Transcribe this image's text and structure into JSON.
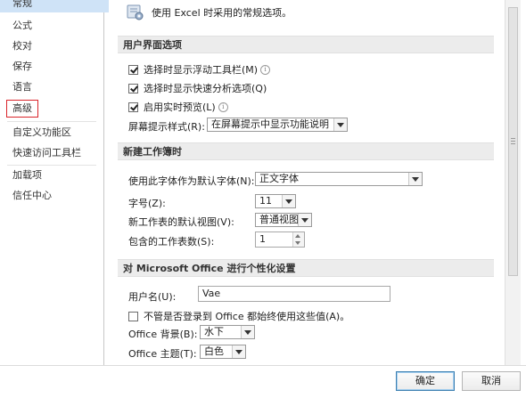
{
  "sidebar": {
    "items": [
      {
        "label": "常规",
        "selected": true
      },
      {
        "label": "公式"
      },
      {
        "label": "校对"
      },
      {
        "label": "保存"
      },
      {
        "label": "语言"
      },
      {
        "label": "高级",
        "highlighted": true
      },
      {
        "label": "自定义功能区"
      },
      {
        "label": "快速访问工具栏"
      },
      {
        "label": "加载项"
      },
      {
        "label": "信任中心"
      }
    ]
  },
  "header": {
    "icon": "options-icon",
    "text": "使用 Excel 时采用的常规选项。"
  },
  "ui_options": {
    "title": "用户界面选项",
    "mini_toolbar": {
      "label": "选择时显示浮动工具栏(M)",
      "checked": true
    },
    "quick_analysis": {
      "label": "选择时显示快速分析选项(Q)",
      "checked": true
    },
    "live_preview": {
      "label": "启用实时预览(L)",
      "checked": true
    },
    "screentip_label": "屏幕提示样式(R):",
    "screentip_value": "在屏幕提示中显示功能说明"
  },
  "new_workbook": {
    "title": "新建工作簿时",
    "font_label": "使用此字体作为默认字体(N):",
    "font_value": "正文字体",
    "size_label": "字号(Z):",
    "size_value": "11",
    "view_label": "新工作表的默认视图(V):",
    "view_value": "普通视图",
    "sheets_label": "包含的工作表数(S):",
    "sheets_value": "1"
  },
  "personalize": {
    "title": "对 Microsoft Office 进行个性化设置",
    "username_label": "用户名(U):",
    "username_value": "Vae",
    "always_use": {
      "label": "不管是否登录到 Office 都始终使用这些值(A)。",
      "checked": false
    },
    "background_label": "Office 背景(B):",
    "background_value": "水下",
    "theme_label": "Office 主题(T):",
    "theme_value": "白色"
  },
  "footer": {
    "ok": "确定",
    "cancel": "取消"
  },
  "colors": {
    "selected_bg": "#cfe3f7",
    "highlight_border": "#d9242a",
    "section_bg": "#ececec"
  }
}
